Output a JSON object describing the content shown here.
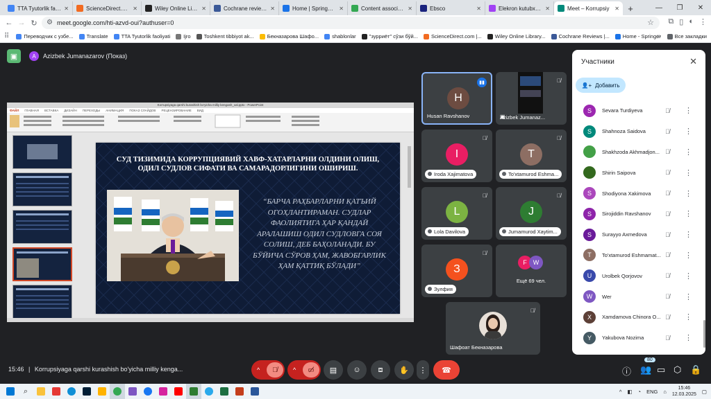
{
  "browser": {
    "tabs": [
      {
        "title": "TTA Tyutorlik faoliyati",
        "color": "#4285f4",
        "active": false
      },
      {
        "title": "ScienceDirect.com | S",
        "color": "#f26b21",
        "active": false
      },
      {
        "title": "Wiley Online Library |",
        "color": "#222222",
        "active": false
      },
      {
        "title": "Cochrane reviews | C",
        "color": "#3b5998",
        "active": false
      },
      {
        "title": "Home | SpringerLink",
        "color": "#1a73e8",
        "active": false
      },
      {
        "title": "Content associated w",
        "color": "#34a853",
        "active": false
      },
      {
        "title": "Ebsco",
        "color": "#1a237e",
        "active": false
      },
      {
        "title": "Elekron kutubxona",
        "color": "#a142f4",
        "active": false
      },
      {
        "title": "Meet – Korrupsiy",
        "color": "#00897b",
        "active": true
      }
    ],
    "new_tab": "+",
    "url": "meet.google.com/hti-azvd-oui?authuser=0",
    "bookmarks": [
      {
        "label": "Переводчик с узбе...",
        "color": "#4285f4"
      },
      {
        "label": "Translate",
        "color": "#4285f4"
      },
      {
        "label": "TTA Tyutorlik faoliyati",
        "color": "#4285f4"
      },
      {
        "label": "Ijro",
        "color": "#777777"
      },
      {
        "label": "Toshkent tibbiyot ak...",
        "color": "#555555"
      },
      {
        "label": "Бекназарова Шафо...",
        "color": "#fbbc04"
      },
      {
        "label": "shablonlar",
        "color": "#4285f4"
      },
      {
        "label": "\"зурриёт\" сўзи бўй...",
        "color": "#222222"
      },
      {
        "label": "ScienceDirect.com |...",
        "color": "#f26b21"
      },
      {
        "label": "Wiley Online Library...",
        "color": "#222222"
      },
      {
        "label": "Cochrane Reviews |...",
        "color": "#3b5998"
      },
      {
        "label": "Home - Springer",
        "color": "#1a73e8"
      }
    ],
    "bookmarks_more": "»",
    "all_bookmarks": "Все закладки"
  },
  "meet": {
    "presenter": "Azizbek Jumanazarov (Показ)",
    "presenter_initial": "A",
    "slide": {
      "window_title": "Korrupsiyaga qarshi kurashish bo'yicha milliy kengash_xal.pptx - PowerPoint",
      "ribbon_tabs": [
        "ФАЙЛ",
        "ГЛАВНАЯ",
        "ВСТАВКА",
        "ДИЗАЙН",
        "ПЕРЕХОДЫ",
        "АНИМАЦИЯ",
        "ПОКАЗ СЛАЙДОВ",
        "РЕЦЕНЗИРОВАНИЕ",
        "ВИД"
      ],
      "title": "СУД ТИЗИМИДА КОРРУПЦИЯВИЙ ХАВФ-ХАТАРЛАРНИ ОЛДИНИ ОЛИШ, ОДИЛ СУДЛОВ СИФАТИ ВА САМАРАДОРЛИГИНИ ОШИРИШ.",
      "quote": "“БАРЧА РАҲБАРЛАРНИ ҚАТЪИЙ ОГОҲЛАНТИРАМАН. СУДЛАР ФАОЛИЯТИГА ҲАР ҚАНДАЙ АРАЛАШИШ ОДИЛ СУДЛОВГА СОЯ СОЛИШ, ДЕБ БАҲОЛАНАДИ. БУ БЎЙИЧА СЎРОВ ҲАМ, ЖАВОБГАРЛИК ҲАМ ҚАТТИҚ БЎЛАДИ”"
    },
    "tiles": [
      {
        "name": "Husan Ravshanov",
        "initial": "H",
        "color": "#6d4c41",
        "kind": "speaking"
      },
      {
        "name": "Azizbek Jumanaz...",
        "initial": "",
        "color": "",
        "kind": "screen"
      },
      {
        "name": "Iroda Xajimatova",
        "initial": "I",
        "color": "#e91e63",
        "kind": "pill"
      },
      {
        "name": "To'xtamurod Eshma...",
        "initial": "T",
        "color": "#8d6e63",
        "kind": "pill"
      },
      {
        "name": "Lola Davilova",
        "initial": "L",
        "color": "#7cb342",
        "kind": "pill"
      },
      {
        "name": "Jumamurod Xaytim...",
        "initial": "J",
        "color": "#2e7d32",
        "kind": "pill"
      },
      {
        "name": "Зулфия",
        "initial": "З",
        "color": "#f4511e",
        "kind": "pill"
      },
      {
        "name": "Ещё 69 чел.",
        "initial": "",
        "color": "",
        "kind": "more"
      },
      {
        "name": "Шафоат Бекназарова",
        "initial": "",
        "color": "",
        "kind": "photo"
      }
    ],
    "more_avatars": [
      {
        "initial": "F",
        "color": "#e91e63"
      },
      {
        "initial": "W",
        "color": "#7e57c2"
      }
    ],
    "panel": {
      "title": "Участники",
      "add_label": "Добавить",
      "participants": [
        {
          "name": "Sevara Turdiyeva",
          "initial": "S",
          "color": "#9c27b0"
        },
        {
          "name": "Shahnoza Saidova",
          "initial": "S",
          "color": "#00897b"
        },
        {
          "name": "Shakhzoda Akhmadjon...",
          "initial": "",
          "color": "#43a047"
        },
        {
          "name": "Shirin Saipova",
          "initial": "",
          "color": "#33691e"
        },
        {
          "name": "Shodiyona Xakimova",
          "initial": "S",
          "color": "#ab47bc"
        },
        {
          "name": "Sirojiddin Ravshanov",
          "initial": "S",
          "color": "#8e24aa"
        },
        {
          "name": "Surayyo Axmedova",
          "initial": "S",
          "color": "#6a1b9a"
        },
        {
          "name": "To'xtamurod Eshmamat...",
          "initial": "T",
          "color": "#8d6e63"
        },
        {
          "name": "Urolbek Qorjovov",
          "initial": "U",
          "color": "#3949ab"
        },
        {
          "name": "Wer",
          "initial": "W",
          "color": "#7e57c2"
        },
        {
          "name": "Xamdamova Chinora O...",
          "initial": "X",
          "color": "#5d4037"
        },
        {
          "name": "Yakubova Nozima",
          "initial": "Y",
          "color": "#455a64"
        }
      ]
    },
    "bottom": {
      "time": "15:46",
      "meeting_title": "Korrupsiyaga qarshi kurashish bo'yicha milliy kenga...",
      "participant_count": "80"
    }
  },
  "taskbar": {
    "lang": "ENG",
    "time": "15:46",
    "date": "12.03.2025"
  }
}
